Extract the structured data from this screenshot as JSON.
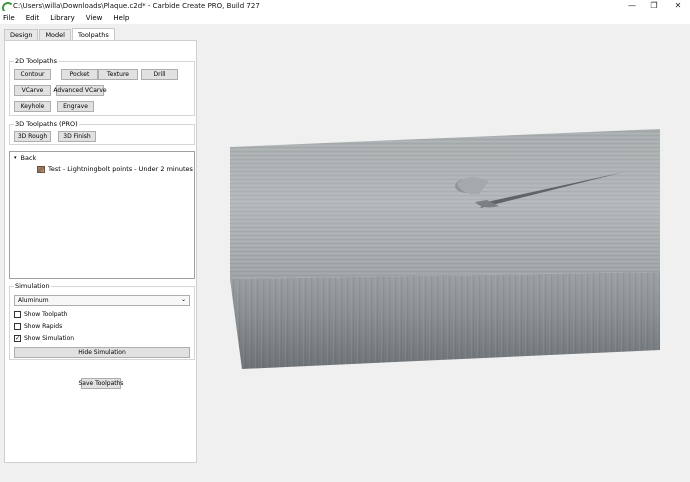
{
  "window": {
    "title": "C:\\Users\\willa\\Downloads\\Plaque.c2d* - Carbide Create PRO, Build 727",
    "minimize": "—",
    "maximize": "❐",
    "close": "✕"
  },
  "menu": [
    "File",
    "Edit",
    "Library",
    "View",
    "Help"
  ],
  "tabs": [
    "Design",
    "Model",
    "Toolpaths"
  ],
  "toolpaths_2d": {
    "title": "2D Toolpaths",
    "buttons": [
      "Contour",
      "Pocket",
      "Texture",
      "Drill",
      "VCarve",
      "Advanced VCarve",
      "Keyhole",
      "Engrave"
    ]
  },
  "toolpaths_3d": {
    "title": "3D Toolpaths (PRO)",
    "buttons": [
      "3D Rough",
      "3D Finish"
    ]
  },
  "tree": {
    "back_label": "Back",
    "collapse_glyph": "▾",
    "items": [
      "Test - Lightningbolt points - Under 2 minutes"
    ]
  },
  "simulation": {
    "title": "Simulation",
    "material": "Aluminum",
    "dropdown_glyph": "⌄",
    "options": [
      {
        "label": "Show Toolpath",
        "checked": false
      },
      {
        "label": "Show Rapids",
        "checked": false
      },
      {
        "label": "Show Simulation",
        "checked": true
      }
    ],
    "check_glyph": "✓",
    "hide_button": "Hide Simulation"
  },
  "save_button": "Save Toolpaths"
}
